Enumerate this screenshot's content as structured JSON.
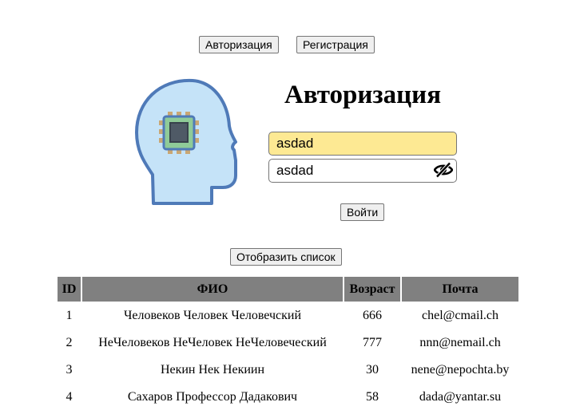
{
  "nav": {
    "auth_label": "Авторизация",
    "register_label": "Регистрация"
  },
  "form": {
    "title": "Авторизация",
    "login_value": "asdad",
    "password_value": "asdad",
    "submit_label": "Войти"
  },
  "list": {
    "show_label": "Отобразить список",
    "columns": [
      "ID",
      "ФИО",
      "Возраст",
      "Почта"
    ],
    "rows": [
      {
        "id": "1",
        "fio": "Человеков Человек Человечский",
        "age": "666",
        "email": "chel@cmail.ch"
      },
      {
        "id": "2",
        "fio": "НеЧеловеков НеЧеловек НеЧеловеческий",
        "age": "777",
        "email": "nnn@nemail.ch"
      },
      {
        "id": "3",
        "fio": "Некин Нек Некиин",
        "age": "30",
        "email": "nene@nepochta.by"
      },
      {
        "id": "4",
        "fio": "Сахаров Профессор Дадакович",
        "age": "58",
        "email": "dada@yantar.su"
      }
    ]
  },
  "icons": {
    "logo": "head-chip-icon",
    "password_toggle": "eye-off-icon"
  },
  "colors": {
    "autofill_bg": "#fde993",
    "table_header_bg": "#808080",
    "head_fill": "#c5e3f8",
    "head_stroke": "#4f7ab8",
    "chip_fill": "#8fcb98"
  }
}
